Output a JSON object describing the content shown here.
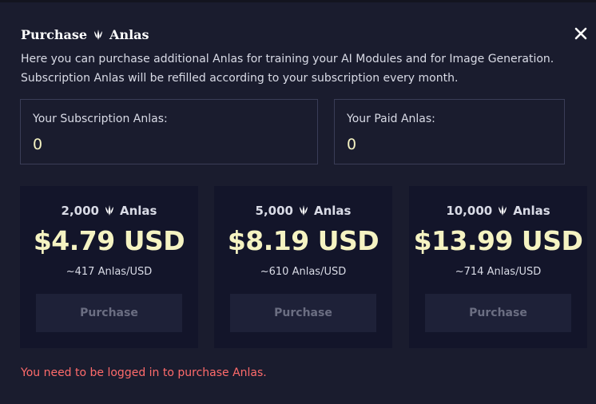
{
  "dialog": {
    "title_part1": "Purchase",
    "title_part2": "Anlas",
    "description": "Here you can purchase additional Anlas for training your AI Modules and for Image Generation. Subscription Anlas will be refilled according to your subscription every month.",
    "close_icon": "close-icon"
  },
  "balances": {
    "subscription": {
      "label": "Your Subscription Anlas:",
      "value": "0"
    },
    "paid": {
      "label": "Your Paid Anlas:",
      "value": "0"
    }
  },
  "packs": [
    {
      "amount": "2,000",
      "unit": "Anlas",
      "price": "$4.79 USD",
      "rate": "~417 Anlas/USD",
      "button": "Purchase"
    },
    {
      "amount": "5,000",
      "unit": "Anlas",
      "price": "$8.19 USD",
      "rate": "~610 Anlas/USD",
      "button": "Purchase"
    },
    {
      "amount": "10,000",
      "unit": "Anlas",
      "price": "$13.99 USD",
      "rate": "~714 Anlas/USD",
      "button": "Purchase"
    }
  ],
  "error_message": "You need to be logged in to purchase Anlas.",
  "colors": {
    "background": "#1a1c2e",
    "card": "#13152a",
    "accent_text": "#f5f3c2",
    "error": "#ff6b6b",
    "button": "#1e2138"
  }
}
